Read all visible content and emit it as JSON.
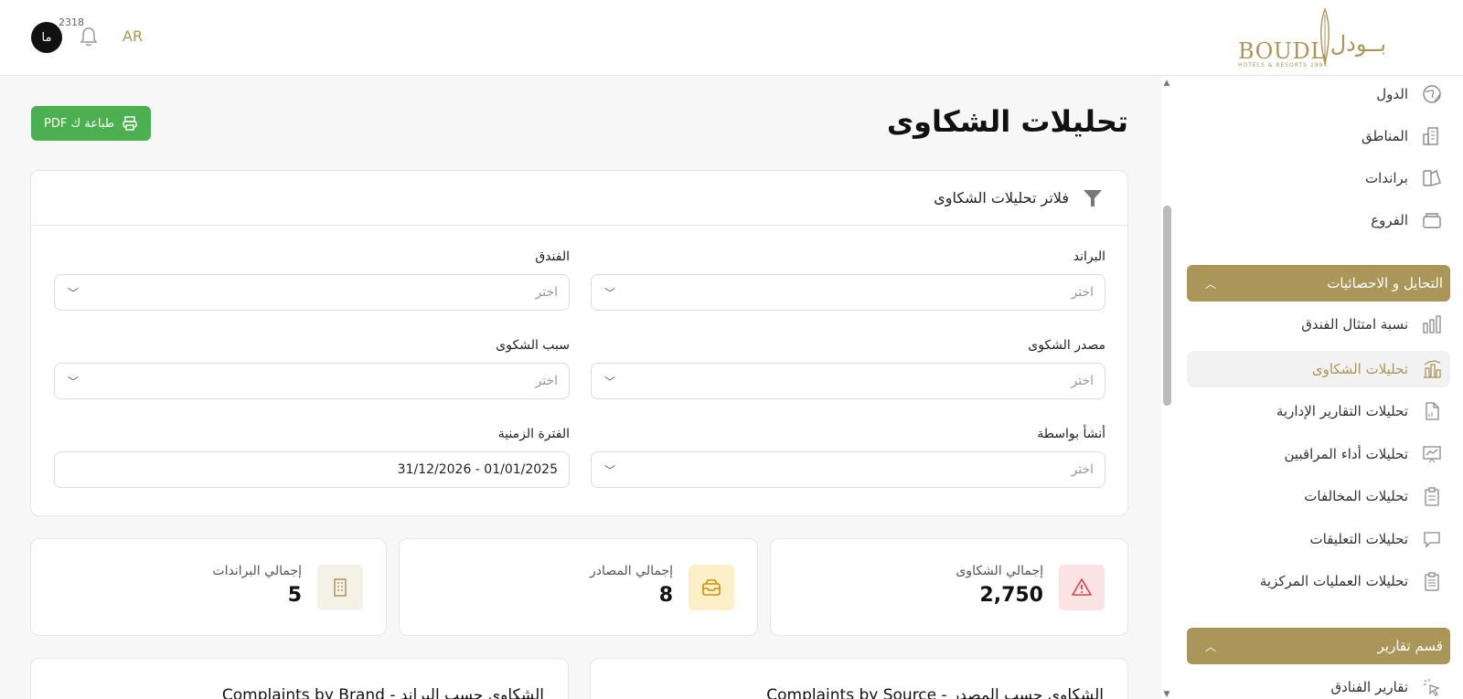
{
  "header": {
    "logo_latin": "BOUDL",
    "logo_arabic": "بــودل",
    "logo_tagline": "HOTELS & RESORTS 1994",
    "language": "AR",
    "notification_count": "2318",
    "avatar_initials": "ما"
  },
  "sidebar": {
    "items_top": [
      {
        "label": "الدول",
        "icon": "globe-icon"
      },
      {
        "label": "المناطق",
        "icon": "building-icon"
      },
      {
        "label": "براندات",
        "icon": "brand-icon"
      },
      {
        "label": "الفروع",
        "icon": "branch-icon"
      }
    ],
    "section_analytics": "التحايل و الاحصائيات",
    "items_analytics": [
      {
        "label": "نسبة امتثال الفندق",
        "icon": "bar-chart-icon"
      },
      {
        "label": "تحليلات الشكاوى",
        "icon": "city-chart-icon",
        "active": true
      },
      {
        "label": "تحليلات التقارير الإدارية",
        "icon": "document-icon"
      },
      {
        "label": "تحليلات أداء المراقبين",
        "icon": "presentation-icon"
      },
      {
        "label": "تحليلات المخالفات",
        "icon": "clipboard-icon"
      },
      {
        "label": "تحليلات التعليقات",
        "icon": "comment-icon"
      },
      {
        "label": "تحليلات العمليات المركزية",
        "icon": "clipboard-list-icon"
      }
    ],
    "section_reports": "قسم تقارير",
    "items_reports": [
      {
        "label": "تقارير الفنادق",
        "icon": "click-icon"
      }
    ]
  },
  "main": {
    "title": "تحليلات الشكاوى",
    "pdf_button": "طباعة ك PDF",
    "filters": {
      "heading": "فلاتر تحليلات الشكاوى",
      "brand_label": "البراند",
      "brand_placeholder": "اختر",
      "hotel_label": "الفندق",
      "hotel_placeholder": "اختر",
      "source_label": "مصدر الشكوى",
      "source_placeholder": "اختر",
      "reason_label": "سبب الشكوى",
      "reason_placeholder": "اختر",
      "created_by_label": "أنشأ بواسطة",
      "created_by_placeholder": "اختر",
      "period_label": "الفترة الزمنية",
      "period_value": "31/12/2026 - 01/01/2025"
    },
    "stats": [
      {
        "label": "إجمالي الشكاوى",
        "value": "2,750",
        "icon": "warning-icon",
        "color": "#fbe3e3"
      },
      {
        "label": "إجمالي المصادر",
        "value": "8",
        "icon": "inbox-icon",
        "color": "#fdf0c9"
      },
      {
        "label": "إجمالي البراندات",
        "value": "5",
        "icon": "building-icon",
        "color": "#f4f1e6"
      }
    ],
    "charts": {
      "by_source": "الشكاوى حسب المصدر - Complaints by Source",
      "by_brand": "الشكاوى حسب البراند - Complaints by Brand"
    }
  }
}
